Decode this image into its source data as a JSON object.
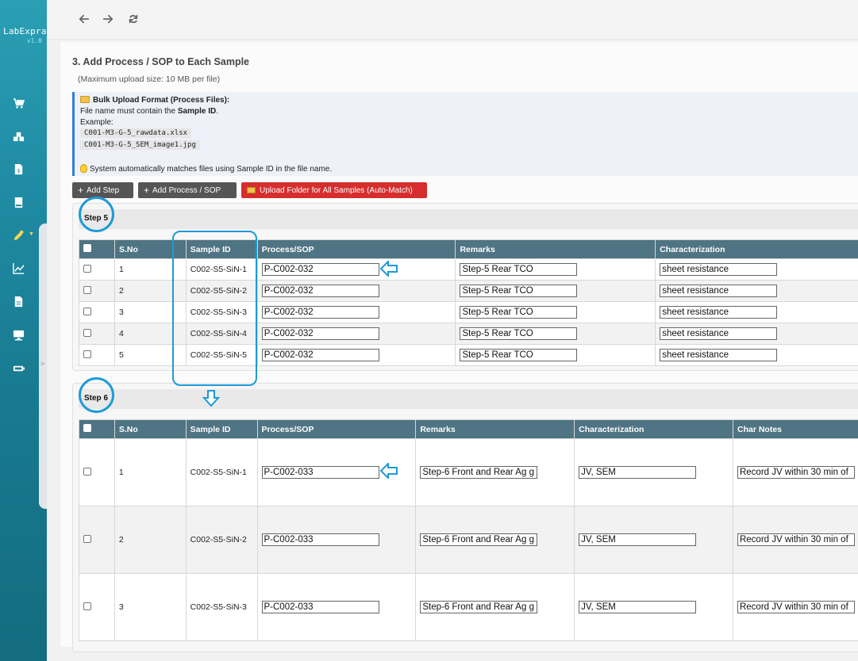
{
  "app": {
    "name": "LabExpra",
    "version": "v1.0"
  },
  "sidebar": {
    "icons": [
      "cart-icon",
      "boxes-icon",
      "document-dollar-icon",
      "book-icon",
      "pipette-icon",
      "chart-line-icon",
      "file-icon",
      "monitor-icon",
      "battery-icon"
    ],
    "active": "pipette-icon",
    "collapse_glyph": ">"
  },
  "topbar": {
    "back": "back-arrow-icon",
    "forward": "forward-arrow-icon",
    "refresh": "refresh-icon"
  },
  "section": {
    "title": "3. Add Process / SOP to Each Sample",
    "upload_size": "(Maximum upload size: 10 MB per file)"
  },
  "info": {
    "heading": "Bulk Upload Format (Process Files):",
    "line1_prefix": "File name must contain the ",
    "line1_bold": "Sample ID",
    "line1_suffix": ".",
    "example_label": "Example:",
    "example1": "C001-M3-G-5_rawdata.xlsx",
    "example2": "C001-M3-G-5_SEM_image1.jpg",
    "tip": "System automatically matches files using Sample ID in the file name."
  },
  "buttons": {
    "add_step": "Add Step",
    "add_process": "Add Process / SOP",
    "upload_folder": "Upload Folder for All Samples (Auto-Match)"
  },
  "step5": {
    "label": "Step 5",
    "columns": [
      "S.No",
      "Sample ID",
      "Process/SOP",
      "Remarks",
      "Characterization"
    ],
    "rows": [
      {
        "sno": "1",
        "sample_id": "C002-S5-SiN-1",
        "process": "P-C002-032",
        "remarks": "Step-5 Rear TCO",
        "char": "sheet resistance"
      },
      {
        "sno": "2",
        "sample_id": "C002-S5-SiN-2",
        "process": "P-C002-032",
        "remarks": "Step-5 Rear TCO",
        "char": "sheet resistance"
      },
      {
        "sno": "3",
        "sample_id": "C002-S5-SiN-3",
        "process": "P-C002-032",
        "remarks": "Step-5 Rear TCO",
        "char": "sheet resistance"
      },
      {
        "sno": "4",
        "sample_id": "C002-S5-SiN-4",
        "process": "P-C002-032",
        "remarks": "Step-5 Rear TCO",
        "char": "sheet resistance"
      },
      {
        "sno": "5",
        "sample_id": "C002-S5-SiN-5",
        "process": "P-C002-032",
        "remarks": "Step-5 Rear TCO",
        "char": "sheet resistance"
      }
    ]
  },
  "step6": {
    "label": "Step 6",
    "columns": [
      "S.No",
      "Sample ID",
      "Process/SOP",
      "Remarks",
      "Characterization",
      "Char Notes"
    ],
    "rows": [
      {
        "sno": "1",
        "sample_id": "C002-S5-SiN-1",
        "process": "P-C002-033",
        "remarks": "Step-6 Front and Rear Ag g",
        "char": "JV, SEM",
        "notes": "Record JV within 30 min of"
      },
      {
        "sno": "2",
        "sample_id": "C002-S5-SiN-2",
        "process": "P-C002-033",
        "remarks": "Step-6 Front and Rear Ag g",
        "char": "JV, SEM",
        "notes": "Record JV within 30 min of"
      },
      {
        "sno": "3",
        "sample_id": "C002-S5-SiN-3",
        "process": "P-C002-033",
        "remarks": "Step-6 Front and Rear Ag g",
        "char": "JV, SEM",
        "notes": "Record JV within 30 min of"
      }
    ]
  },
  "colors": {
    "accent": "#1e9ad6",
    "header": "#4f7483",
    "danger": "#d62d2d"
  }
}
